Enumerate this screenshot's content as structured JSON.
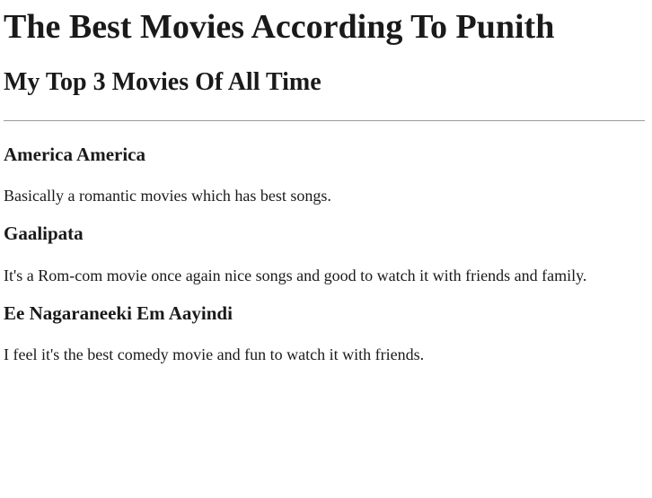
{
  "page": {
    "title": "The Best Movies According To Punith",
    "subtitle": "My Top 3 Movies Of All Time"
  },
  "movies": [
    {
      "name": "America America",
      "description": "Basically a romantic movies which has best songs."
    },
    {
      "name": "Gaalipata",
      "description": "It's a Rom-com movie once again nice songs and good to watch it with friends and family."
    },
    {
      "name": "Ee Nagaraneeki Em Aayindi",
      "description": "I feel it's the best comedy movie and fun to watch it with friends."
    }
  ]
}
